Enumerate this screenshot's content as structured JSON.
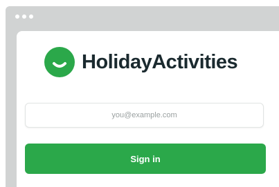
{
  "window": {
    "chrome_color": "#d1d3d3",
    "traffic_dots": [
      "dot",
      "dot",
      "dot"
    ]
  },
  "brand": {
    "logo_icon": "smiley-face-icon",
    "name": "HolidayActivities",
    "accent_color": "#2ba84a",
    "text_color": "#1b2a2f"
  },
  "login_form": {
    "email_value": "",
    "email_placeholder": "you@example.com",
    "submit_label": "Sign in",
    "submit_color": "#2ba84a"
  }
}
